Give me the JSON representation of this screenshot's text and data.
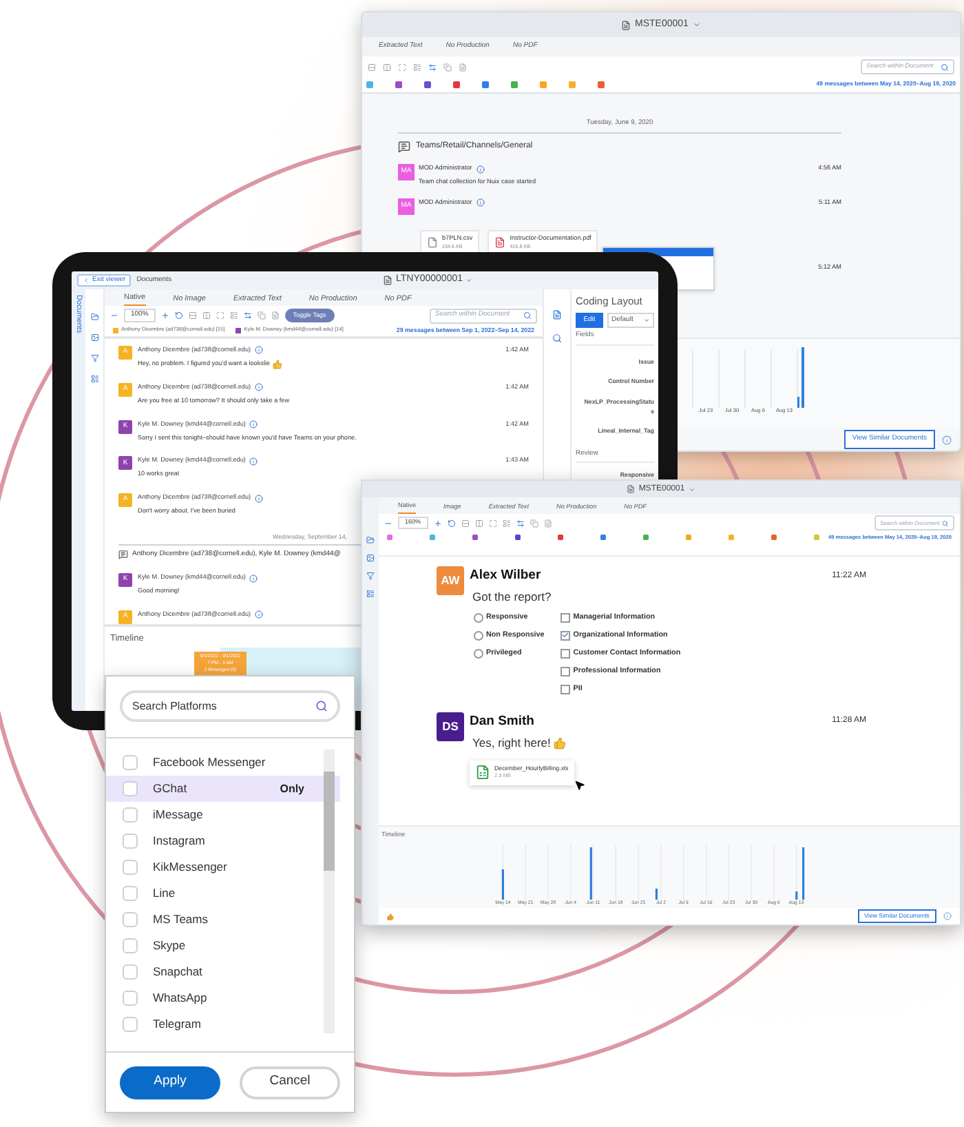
{
  "back_window": {
    "title": "MSTE00001",
    "tabs": [
      {
        "label": "Extracted Text",
        "selected": false
      },
      {
        "label": "No Production",
        "selected": false
      },
      {
        "label": "No PDF",
        "selected": false
      }
    ],
    "search": {
      "placeholder": "Search within Document"
    },
    "participant_chips": [
      {
        "color": "#4fb3e6"
      },
      {
        "color": "#9b4fc0"
      },
      {
        "color": "#6a4fd6"
      },
      {
        "color": "#e03a3a"
      },
      {
        "color": "#2f80ed"
      },
      {
        "color": "#4caf50"
      },
      {
        "color": "#f5a623"
      },
      {
        "color": "#f2b230"
      },
      {
        "color": "#e8612c"
      }
    ],
    "summary": "49 messages between May 14, 2020–Aug 19, 2020",
    "date": "Tuesday, June 9, 2020",
    "channel": "Teams/Retail/Channels/General",
    "messages": [
      {
        "initials": "MA",
        "color": "#ea5fe0",
        "sender": "MOD Administrator",
        "time": "4:56 AM",
        "text": "Team chat collection for Nuix case started"
      },
      {
        "initials": "MA",
        "color": "#ea5fe0",
        "sender": "MOD Administrator",
        "time": "5:11 AM"
      }
    ],
    "attachments": [
      {
        "kind": "file",
        "name": "b7PLN.csv",
        "size": "234.6 KB"
      },
      {
        "kind": "pdf",
        "name": "Instructor-Documentation.pdf",
        "size": "415.8 KB"
      }
    ],
    "later_time": "5:12 AM",
    "timeline_ticks": [
      "Jul 23",
      "Jul 30",
      "Aug 6",
      "Aug 13"
    ],
    "similar_button": "View Similar Documents"
  },
  "tablet": {
    "exit_button": "Exit viewer",
    "breadcrumb": "Documents",
    "title": "LTNY00000001",
    "side_label": "Documents",
    "tabs": [
      {
        "label": "Native",
        "selected": true
      },
      {
        "label": "No Image",
        "selected": false
      },
      {
        "label": "Extracted Text",
        "selected": false
      },
      {
        "label": "No Production",
        "selected": false
      },
      {
        "label": "No PDF",
        "selected": false
      }
    ],
    "zoom": "100%",
    "toggle_button": "Toggle Tags",
    "search": {
      "placeholder": "Search within Document"
    },
    "participants": [
      {
        "label": "Anthony Dicembre (ad738@cornell.edu) [15]",
        "color": "#f5b324"
      },
      {
        "label": "Kyle M. Downey (kmd44@cornell.edu) [14]",
        "color": "#8e44ad"
      }
    ],
    "summary": "29 messages between Sep 1, 2022–Sep 14, 2022",
    "messages": [
      {
        "initials": "A",
        "color": "#f5b324",
        "sender": "Anthony Dicembre (ad738@cornell.edu)",
        "time": "1:42 AM",
        "text": "Hey, no problem. I figured you'd want a lookslie",
        "thumbs_up": true
      },
      {
        "initials": "A",
        "color": "#f5b324",
        "sender": "Anthony Dicembre (ad738@cornell.edu)",
        "time": "1:42 AM",
        "text": "Are you free at 10 tomorrow? It should only take a few"
      },
      {
        "initials": "K",
        "color": "#8e44ad",
        "sender": "Kyle M. Downey (kmd44@cornell.edu)",
        "time": "1:42 AM",
        "text": "Sorry I sent this tonight–should have known you'd have Teams on your phone."
      },
      {
        "initials": "K",
        "color": "#8e44ad",
        "sender": "Kyle M. Downey (kmd44@cornell.edu)",
        "time": "1:43 AM",
        "text": "10 works great"
      },
      {
        "initials": "A",
        "color": "#f5b324",
        "sender": "Anthony Dicembre (ad738@cornell.edu)",
        "text": "Don't worry about. I've been buried"
      }
    ],
    "date": "Wednesday, September 14,",
    "conversation": "Anthony Dicembre (ad738@cornell.edu), Kyle M. Downey (kmd44@",
    "later_messages": [
      {
        "initials": "K",
        "color": "#8e44ad",
        "sender": "Kyle M. Downey (kmd44@cornell.edu)",
        "text": "Good morning!"
      },
      {
        "initials": "A",
        "color": "#f5b324",
        "sender": "Anthony Dicembre (ad738@cornell.edu)"
      }
    ],
    "timeline_label": "Timeline",
    "tooltip": [
      "9/1/2022 - 9/1/2022",
      "7 PM - 1 AM",
      "2 Messages (0)"
    ],
    "coding": {
      "title": "Coding Layout",
      "edit": "Edit",
      "layout": "Default",
      "fields_heading": "Fields",
      "fields": [
        "Issue",
        "Control Number",
        "NexLP_ProcessingStatus",
        "Lineal_Internal_Tag"
      ],
      "review_heading": "Review",
      "review_fields": [
        "Responsive"
      ]
    }
  },
  "front_window": {
    "title": "MSTE00001",
    "tabs": [
      {
        "label": "Native",
        "selected": true
      },
      {
        "label": "Image",
        "selected": false
      },
      {
        "label": "Extracted Text",
        "selected": false
      },
      {
        "label": "No Production",
        "selected": false
      },
      {
        "label": "No PDF",
        "selected": false
      }
    ],
    "zoom": "160%",
    "search": {
      "placeholder": "Search within Document"
    },
    "participant_chips": [
      {
        "color": "#e86ae0"
      },
      {
        "color": "#4fb3e6"
      },
      {
        "color": "#9b4fc0"
      },
      {
        "color": "#5a3fd0"
      },
      {
        "color": "#e03a3a"
      },
      {
        "color": "#2f80ed"
      },
      {
        "color": "#4caf50"
      },
      {
        "color": "#f5a623"
      },
      {
        "color": "#f2b230"
      },
      {
        "color": "#e8612c"
      },
      {
        "color": "#d4c640"
      }
    ],
    "summary": "49 messages between May 14, 2020–Aug 19, 2020",
    "messages": [
      {
        "initials": "AW",
        "color": "#ee8a3c",
        "sender": "Alex Wilber",
        "time": "11:22 AM",
        "text": "Got the report?",
        "radios": [
          {
            "label": "Responsive",
            "selected": false
          },
          {
            "label": "Non Responsive",
            "selected": false
          },
          {
            "label": "Privileged",
            "selected": false
          }
        ],
        "checkboxes": [
          {
            "label": "Managerial Information",
            "checked": false
          },
          {
            "label": "Organizational Information",
            "checked": true
          },
          {
            "label": "Customer Contact Information",
            "checked": false
          },
          {
            "label": "Professional Information",
            "checked": false
          },
          {
            "label": "PII",
            "checked": false
          }
        ]
      },
      {
        "initials": "DS",
        "color": "#4a1d8f",
        "sender": "Dan Smith",
        "time": "11:28 AM",
        "text": "Yes, right here!",
        "thumbs_up": true,
        "attachment": {
          "name": "December_HourlyBilling.xls",
          "size": "2.3 MB"
        }
      }
    ],
    "timeline_label": "Timeline",
    "timeline_ticks": [
      "May 14",
      "May 21",
      "May 28",
      "Jun 4",
      "Jun 11",
      "Jun 18",
      "Jun 25",
      "Jul 2",
      "Jul 9",
      "Jul 16",
      "Jul 23",
      "Jul 30",
      "Aug 6",
      "Aug 13"
    ],
    "similar_button": "View Similar Documents"
  },
  "platform_filter": {
    "search": {
      "placeholder": "Search Platforms"
    },
    "only_label": "Only",
    "items": [
      {
        "label": "Facebook Messenger",
        "checked": false,
        "selected": false
      },
      {
        "label": "GChat",
        "checked": false,
        "selected": true
      },
      {
        "label": "iMessage",
        "checked": false,
        "selected": false
      },
      {
        "label": "Instagram",
        "checked": false,
        "selected": false
      },
      {
        "label": "KikMessenger",
        "checked": false,
        "selected": false
      },
      {
        "label": "Line",
        "checked": false,
        "selected": false
      },
      {
        "label": "MS Teams",
        "checked": false,
        "selected": false
      },
      {
        "label": "Skype",
        "checked": false,
        "selected": false
      },
      {
        "label": "Snapchat",
        "checked": false,
        "selected": false
      },
      {
        "label": "WhatsApp",
        "checked": false,
        "selected": false
      },
      {
        "label": "Telegram",
        "checked": false,
        "selected": false
      }
    ],
    "buttons": [
      {
        "kind": "primary",
        "label": "Apply"
      },
      {
        "kind": "secondary",
        "label": "Cancel"
      }
    ]
  }
}
